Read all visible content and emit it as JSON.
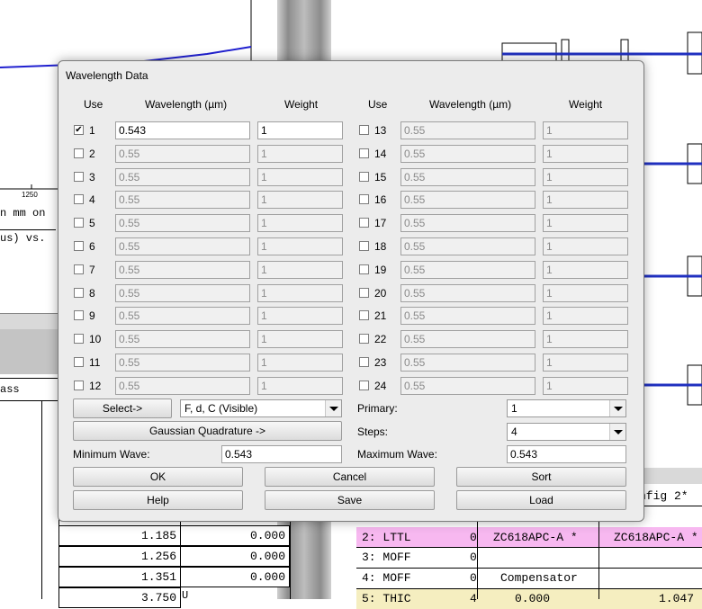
{
  "background": {
    "plot_tick": "1250",
    "plot_text_1": "n mm on",
    "plot_text_2": "us) vs.",
    "table_header": "ass",
    "left_values": [
      "1.185",
      "1.256",
      "1.351",
      "3.750"
    ],
    "left_zero": [
      "0.000",
      "0.000",
      "0.000"
    ],
    "left_flag": "U",
    "config_label": "nfig 2*",
    "lde_rows": [
      {
        "label": "2: LTTL",
        "thick": "0",
        "c1": "ZC618APC-A *",
        "c2": "ZC618APC-A *"
      },
      {
        "label": "3: MOFF",
        "thick": "0",
        "c1": "",
        "c2": ""
      },
      {
        "label": "4: MOFF",
        "thick": "0",
        "c1": "Compensator",
        "c2": ""
      },
      {
        "label": "5: THIC",
        "thick": "4",
        "c1": "0.000",
        "c2": "1.047"
      }
    ]
  },
  "dialog": {
    "title": "Wavelength Data",
    "headers": {
      "use": "Use",
      "wavelength": "Wavelength (µm)",
      "weight": "Weight"
    },
    "rows_left": [
      {
        "n": "1",
        "checked": true,
        "wave": "0.543",
        "weight": "1"
      },
      {
        "n": "2",
        "checked": false,
        "wave": "0.55",
        "weight": "1"
      },
      {
        "n": "3",
        "checked": false,
        "wave": "0.55",
        "weight": "1"
      },
      {
        "n": "4",
        "checked": false,
        "wave": "0.55",
        "weight": "1"
      },
      {
        "n": "5",
        "checked": false,
        "wave": "0.55",
        "weight": "1"
      },
      {
        "n": "6",
        "checked": false,
        "wave": "0.55",
        "weight": "1"
      },
      {
        "n": "7",
        "checked": false,
        "wave": "0.55",
        "weight": "1"
      },
      {
        "n": "8",
        "checked": false,
        "wave": "0.55",
        "weight": "1"
      },
      {
        "n": "9",
        "checked": false,
        "wave": "0.55",
        "weight": "1"
      },
      {
        "n": "10",
        "checked": false,
        "wave": "0.55",
        "weight": "1"
      },
      {
        "n": "11",
        "checked": false,
        "wave": "0.55",
        "weight": "1"
      },
      {
        "n": "12",
        "checked": false,
        "wave": "0.55",
        "weight": "1"
      }
    ],
    "rows_right": [
      {
        "n": "13",
        "checked": false,
        "wave": "0.55",
        "weight": "1"
      },
      {
        "n": "14",
        "checked": false,
        "wave": "0.55",
        "weight": "1"
      },
      {
        "n": "15",
        "checked": false,
        "wave": "0.55",
        "weight": "1"
      },
      {
        "n": "16",
        "checked": false,
        "wave": "0.55",
        "weight": "1"
      },
      {
        "n": "17",
        "checked": false,
        "wave": "0.55",
        "weight": "1"
      },
      {
        "n": "18",
        "checked": false,
        "wave": "0.55",
        "weight": "1"
      },
      {
        "n": "19",
        "checked": false,
        "wave": "0.55",
        "weight": "1"
      },
      {
        "n": "20",
        "checked": false,
        "wave": "0.55",
        "weight": "1"
      },
      {
        "n": "21",
        "checked": false,
        "wave": "0.55",
        "weight": "1"
      },
      {
        "n": "22",
        "checked": false,
        "wave": "0.55",
        "weight": "1"
      },
      {
        "n": "23",
        "checked": false,
        "wave": "0.55",
        "weight": "1"
      },
      {
        "n": "24",
        "checked": false,
        "wave": "0.55",
        "weight": "1"
      }
    ],
    "select_button": "Select->",
    "preset_value": "F, d, C (Visible)",
    "primary_label": "Primary:",
    "primary_value": "1",
    "gaussian_button": "Gaussian Quadrature ->",
    "steps_label": "Steps:",
    "steps_value": "4",
    "min_wave_label": "Minimum Wave:",
    "min_wave_value": "0.543",
    "max_wave_label": "Maximum Wave:",
    "max_wave_value": "0.543",
    "buttons": {
      "ok": "OK",
      "cancel": "Cancel",
      "sort": "Sort",
      "help": "Help",
      "save": "Save",
      "load": "Load"
    }
  }
}
